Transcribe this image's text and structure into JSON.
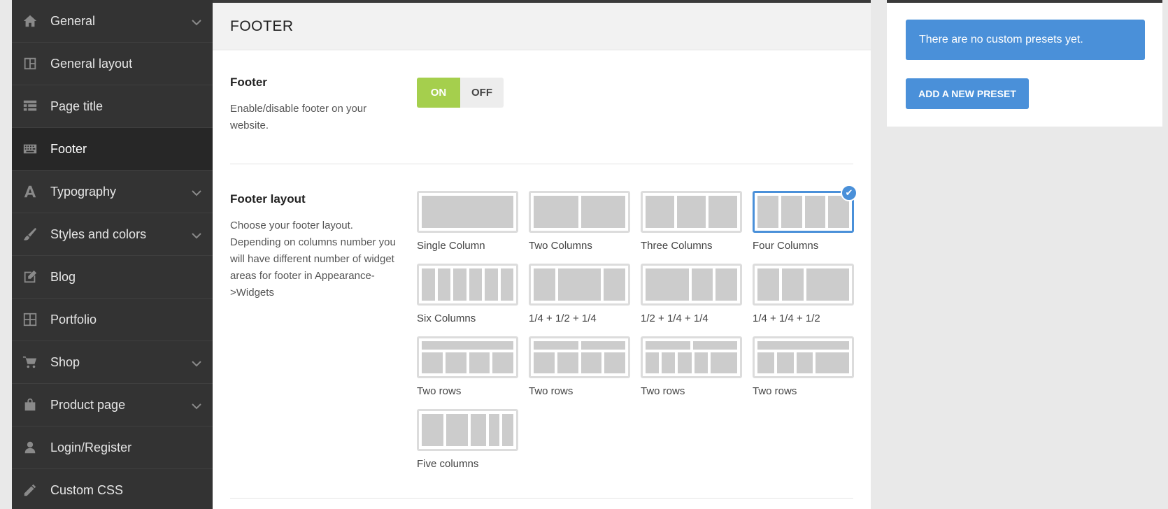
{
  "sidebar": {
    "items": [
      {
        "label": "General",
        "icon": "home-icon",
        "has_chevron": true,
        "active": false
      },
      {
        "label": "General layout",
        "icon": "layout-icon",
        "has_chevron": false,
        "active": false
      },
      {
        "label": "Page title",
        "icon": "grid-icon",
        "has_chevron": false,
        "active": false
      },
      {
        "label": "Footer",
        "icon": "keyboard-icon",
        "has_chevron": false,
        "active": true
      },
      {
        "label": "Typography",
        "icon": "typography-icon",
        "has_chevron": true,
        "active": false
      },
      {
        "label": "Styles and colors",
        "icon": "brush-icon",
        "has_chevron": true,
        "active": false
      },
      {
        "label": "Blog",
        "icon": "edit-icon",
        "has_chevron": false,
        "active": false
      },
      {
        "label": "Portfolio",
        "icon": "portfolio-icon",
        "has_chevron": false,
        "active": false
      },
      {
        "label": "Shop",
        "icon": "cart-icon",
        "has_chevron": true,
        "active": false
      },
      {
        "label": "Product page",
        "icon": "bag-icon",
        "has_chevron": true,
        "active": false
      },
      {
        "label": "Login/Register",
        "icon": "user-icon",
        "has_chevron": false,
        "active": false
      },
      {
        "label": "Custom CSS",
        "icon": "tools-icon",
        "has_chevron": false,
        "active": false
      }
    ]
  },
  "main": {
    "title": "FOOTER",
    "footer_toggle": {
      "heading": "Footer",
      "description": "Enable/disable footer on your website.",
      "on_label": "ON",
      "off_label": "OFF",
      "value": "ON"
    },
    "footer_layout": {
      "heading": "Footer layout",
      "description": "Choose your footer layout. Depending on columns number you will have different number of widget areas for footer in Appearance->Widgets",
      "selected": "Four Columns",
      "options": [
        "Single Column",
        "Two Columns",
        "Three Columns",
        "Four Columns",
        "Six Columns",
        "1/4 + 1/2 + 1/4",
        "1/2 + 1/4 + 1/4",
        "1/4 + 1/4 + 1/2",
        "Two rows",
        "Two rows",
        "Two rows",
        "Two rows",
        "Five columns"
      ]
    }
  },
  "presets": {
    "notice": "There are no custom presets yet.",
    "add_button": "ADD A NEW PRESET"
  },
  "colors": {
    "sidebar_bg": "#333333",
    "accent_blue": "#4a90d9",
    "toggle_on": "#a5cf4d"
  }
}
